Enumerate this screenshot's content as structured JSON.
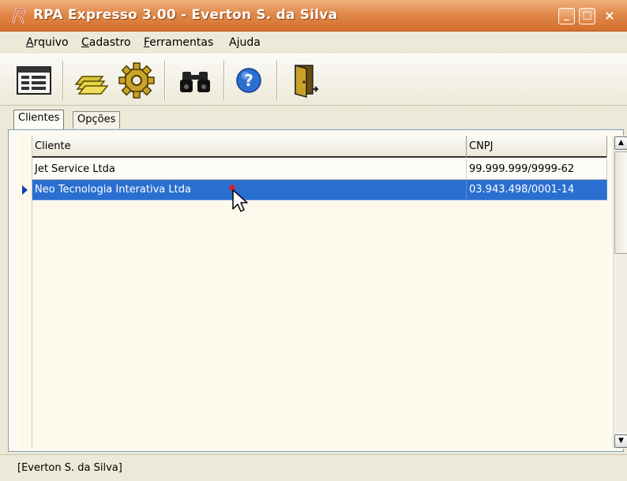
{
  "window": {
    "title": "RPA Expresso 3.00 - Everton S. da Silva",
    "controls": {
      "minimize": "_",
      "maximize": "□",
      "close": "×"
    }
  },
  "menu": [
    {
      "label": "Arquivo",
      "accel": "A"
    },
    {
      "label": "Cadastro",
      "accel": "C"
    },
    {
      "label": "Ferramentas",
      "accel": "F"
    },
    {
      "label": "Ajuda",
      "accel": "j"
    }
  ],
  "toolbar": [
    {
      "icon": "form-window-icon"
    },
    {
      "icon": "stacked-folders-icon"
    },
    {
      "icon": "gear-icon"
    },
    {
      "icon": "binoculars-icon"
    },
    {
      "icon": "help-icon"
    },
    {
      "icon": "exit-door-icon"
    }
  ],
  "tabs": [
    {
      "label": "Clientes",
      "active": true
    },
    {
      "label": "Opções",
      "active": false
    }
  ],
  "grid": {
    "columns": [
      "Cliente",
      "CNPJ"
    ],
    "rows": [
      [
        "Jet Service Ltda",
        "99.999.999/9999-62"
      ],
      [
        "Neo Tecnologia Interativa Ltda",
        "03.943.498/0001-14"
      ]
    ],
    "selected_row": 1
  },
  "colors": {
    "titlebar": "#dd7f3f",
    "selection": "#2a6fd0"
  },
  "status": "[Everton S. da Silva]"
}
